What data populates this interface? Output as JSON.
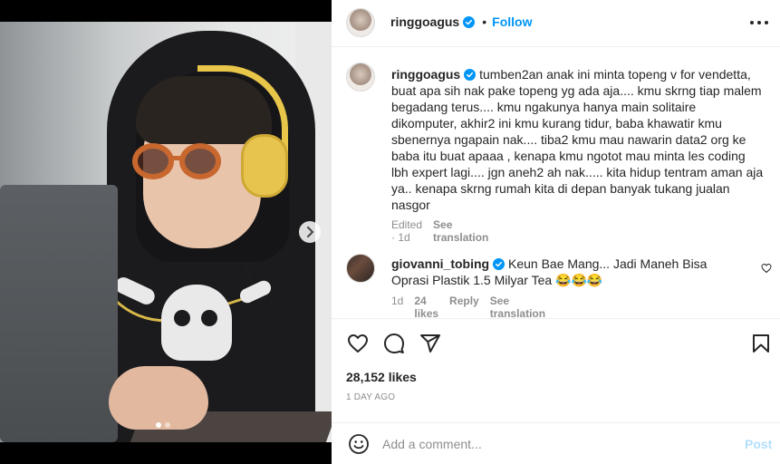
{
  "post": {
    "username": "ringgoagus",
    "follow_label": "Follow",
    "separator": "•"
  },
  "caption": {
    "username": "ringgoagus",
    "text": "tumben2an anak ini minta topeng v for vendetta, buat apa sih nak pake topeng yg ada aja.... kmu skrng tiap malem begadang terus.... kmu ngakunya hanya main solitaire dikomputer, akhir2 ini kmu kurang tidur, baba khawatir kmu sbenernya ngapain nak.... tiba2 kmu mau nawarin data2 org ke baba itu buat apaaa , kenapa kmu ngotot mau minta les coding lbh expert lagi.... jgn aneh2 ah nak..... kita hidup tentram aman aja ya.. kenapa skrng rumah kita di depan banyak tukang jualan nasgor",
    "edited": "Edited",
    "time": "1d",
    "see_translation": "See translation"
  },
  "comment": {
    "username": "giovanni_tobing",
    "text": "Keun Bae Mang... Jadi Maneh Bisa Oprasi Plastik 1.5 Milyar Tea 😂😂😂",
    "time": "1d",
    "likes": "24 likes",
    "reply": "Reply",
    "see_translation": "See translation"
  },
  "stats": {
    "likes": "28,152 likes",
    "date": "1 DAY AGO"
  },
  "add_comment": {
    "placeholder": "Add a comment...",
    "post_label": "Post"
  },
  "carousel": {
    "current_slide": 1,
    "total_slides": 2
  },
  "colors": {
    "accent": "#0095f6",
    "post_disabled": "#b2dffc",
    "muted": "#8e8e8e",
    "verified": "#0095f6"
  },
  "icons": [
    "chevron-right-icon",
    "more-icon",
    "verified-icon",
    "heart-icon",
    "comment-icon",
    "share-icon",
    "bookmark-icon",
    "emoji-icon"
  ]
}
